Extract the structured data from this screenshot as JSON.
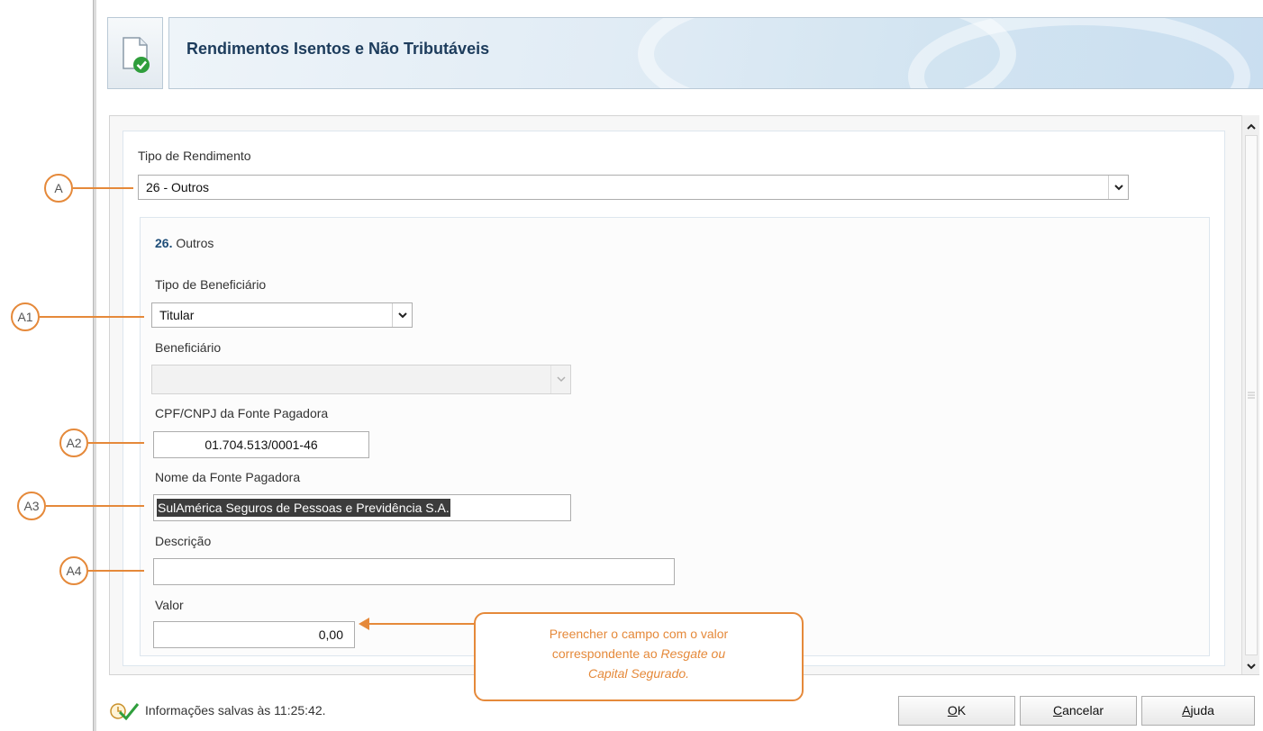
{
  "window": {
    "title": "Rendimentos Isentos e Não Tributáveis"
  },
  "form": {
    "tipo_rendimento_label": "Tipo de Rendimento",
    "tipo_rendimento_value": "26 - Outros",
    "section_number": "26.",
    "section_title": "Outros",
    "tipo_beneficiario_label": "Tipo de Beneficiário",
    "tipo_beneficiario_value": "Titular",
    "beneficiario_label": "Beneficiário",
    "beneficiario_value": "",
    "cpf_label": "CPF/CNPJ da Fonte Pagadora",
    "cpf_value": "01.704.513/0001-46",
    "nome_label": "Nome da Fonte Pagadora",
    "nome_value": "SulAmérica Seguros de Pessoas e Previdência S.A.",
    "descricao_label": "Descrição",
    "descricao_value": "",
    "valor_label": "Valor",
    "valor_value": "0,00"
  },
  "annotations": {
    "a": "A",
    "a1": "A1",
    "a2": "A2",
    "a3": "A3",
    "a4": "A4",
    "callout_line1": "Preencher o campo com o valor",
    "callout_line2_plain": "correspondente ao ",
    "callout_line2_italic": "Resgate ou",
    "callout_line3_italic": "Capital Segurado."
  },
  "status": {
    "text": "Informações salvas às 11:25:42."
  },
  "buttons": {
    "ok_mnemonic": "O",
    "ok_rest": "K",
    "cancel_mnemonic": "C",
    "cancel_rest": "ancelar",
    "help_mnemonic": "A",
    "help_rest": "juda"
  },
  "colors": {
    "annotation": "#e5893a",
    "title": "#1d3c5c",
    "section_number": "#1f4e79"
  },
  "icons": {
    "header": "document-check-icon",
    "status": "saved-check-icon",
    "combo_arrow": "chevron-down-icon",
    "scroll_up": "chevron-up-icon",
    "scroll_down": "chevron-down-icon"
  }
}
